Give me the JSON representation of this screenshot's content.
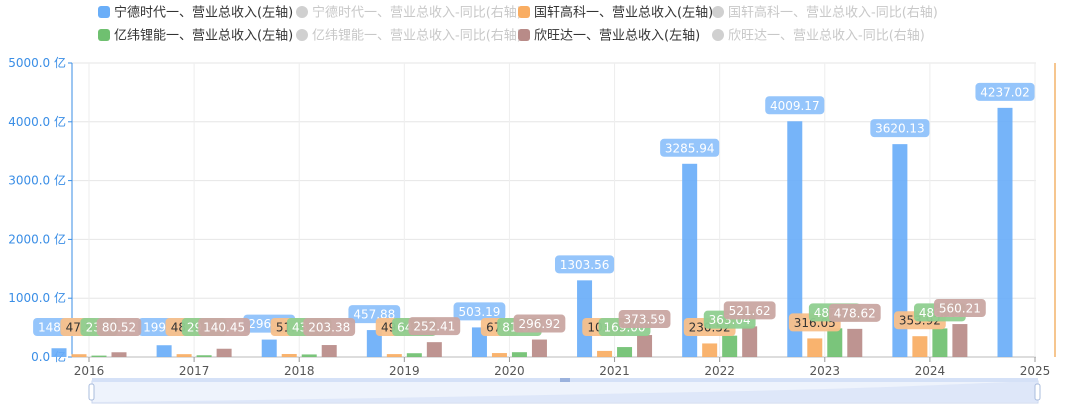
{
  "chart_data": {
    "type": "bar",
    "categories": [
      "2016",
      "2017",
      "2018",
      "2019",
      "2020",
      "2021",
      "2022",
      "2023",
      "2024",
      "2025"
    ],
    "y_unit": "亿",
    "y_ticks": [
      "0.0 亿",
      "1000.0 亿",
      "2000.0 亿",
      "3000.0 亿",
      "4000.0 亿",
      "5000.0 亿"
    ],
    "ylim": [
      0,
      5000
    ],
    "grid": true,
    "legend_position": "top",
    "legend": [
      {
        "name": "宁德时代一、营业总收入(左轴)",
        "color": "#6aaef8",
        "active": true
      },
      {
        "name": "宁德时代一、营业总收入-同比(右轴)",
        "color": "#d0d0d0",
        "active": false
      },
      {
        "name": "国轩高科一、营业总收入(左轴)",
        "color": "#f9ad62",
        "active": true
      },
      {
        "name": "国轩高科一、营业总收入-同比(右轴)",
        "color": "#d0d0d0",
        "active": false
      },
      {
        "name": "亿纬锂能一、营业总收入(左轴)",
        "color": "#6fc070",
        "active": true
      },
      {
        "name": "亿纬锂能一、营业总收入-同比(右轴)",
        "color": "#d0d0d0",
        "active": false
      },
      {
        "name": "欣旺达一、营业总收入(左轴)",
        "color": "#b88b88",
        "active": true
      },
      {
        "name": "欣旺达一、营业总收入-同比(右轴)",
        "color": "#d0d0d0",
        "active": false
      }
    ],
    "series": [
      {
        "name": "宁德时代一、营业总收入(左轴)",
        "color": "#6aaef8",
        "values": [
          148.79,
          199.97,
          296.11,
          457.88,
          503.19,
          1303.56,
          3285.94,
          4009.17,
          3620.13,
          4237.02
        ],
        "labels": [
          "148.79",
          "199.97",
          "296.11",
          "457.88",
          "503.19",
          "1303.56",
          "3285.94",
          "4009.17",
          "3620.13",
          "4237.02"
        ]
      },
      {
        "name": "国轩高科一、营业总收入(左轴)",
        "color": "#f9ad62",
        "values": [
          47.5,
          48.3,
          51.2,
          49.5,
          67.2,
          103.56,
          230.52,
          316.05,
          353.92,
          null
        ],
        "labels": [
          "47.5",
          "48.3",
          "51.2",
          "49.5",
          "67.2",
          "103.5",
          "230.52",
          "316.05",
          "353.92",
          ""
        ]
      },
      {
        "name": "亿纬锂能一、营业总收入(左轴)",
        "color": "#6fc070",
        "values": [
          23.8,
          29.8,
          43.5,
          64.12,
          81.62,
          169.0,
          363.04,
          487.84,
          486.15,
          null
        ],
        "labels": [
          "23.8",
          "29.82",
          "43.51",
          "64.12",
          "81.62",
          "169.00",
          "363.04",
          "487.84",
          "486.15",
          ""
        ]
      },
      {
        "name": "欣旺达一、营业总收入(左轴)",
        "color": "#b88b88",
        "values": [
          80.52,
          140.45,
          203.38,
          252.41,
          296.92,
          373.59,
          521.62,
          478.62,
          560.21,
          null
        ],
        "labels": [
          "80.52",
          "140.45",
          "203.38",
          "252.41",
          "296.92",
          "373.59",
          "521.62",
          "478.62",
          "560.21",
          ""
        ]
      }
    ]
  }
}
